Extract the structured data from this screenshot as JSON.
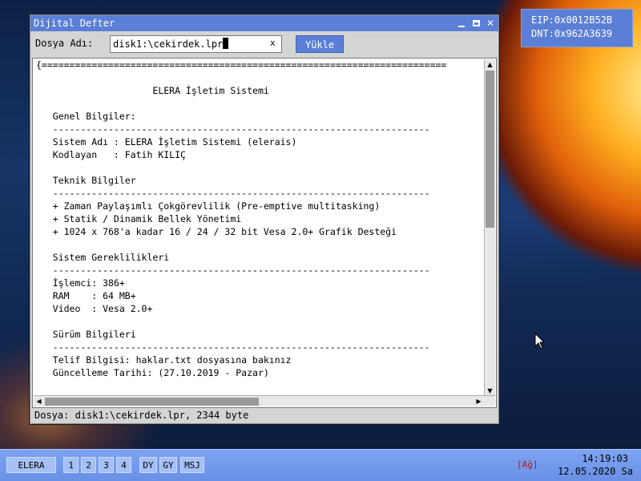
{
  "window": {
    "title": "Dijital Defter",
    "controls": {
      "close": "✕"
    },
    "file_label": "Dosya Adı:",
    "file_input_value": "disk1:\\cekirdek.lpr",
    "clear_label": "x",
    "load_button": "Yükle",
    "text_lines": [
      "{=========================================================================",
      "",
      "                     ELERA İşletim Sistemi",
      "",
      "   Genel Bilgiler:",
      "   --------------------------------------------------------------------",
      "   Sistem Adı : ELERA İşletim Sistemi (elerais)",
      "   Kodlayan   : Fatih KILIÇ",
      "",
      "   Teknik Bilgiler",
      "   --------------------------------------------------------------------",
      "   + Zaman Paylaşımlı Çokgörevlilik (Pre-emptive multitasking)",
      "   + Statik / Dinamik Bellek Yönetimi",
      "   + 1024 x 768'a kadar 16 / 24 / 32 bit Vesa 2.0+ Grafik Desteği",
      "",
      "   Sistem Gereklilikleri",
      "   --------------------------------------------------------------------",
      "   İşlemci: 386+",
      "   RAM    : 64 MB+",
      "   Video  : Vesa 2.0+",
      "",
      "   Sürüm Bilgileri",
      "   --------------------------------------------------------------------",
      "   Telif Bilgisi: haklar.txt dosyasına bakınız",
      "   Güncelleme Tarihi: (27.10.2019 - Pazar)"
    ],
    "scroll": {
      "up": "▲",
      "down": "▼",
      "left": "◀",
      "right": "▶"
    },
    "status": "Dosya: disk1:\\cekirdek.lpr, 2344 byte"
  },
  "registers": {
    "eip": "EIP:0x0012B52B",
    "dnt": "DNT:0x962A3639"
  },
  "taskbar": {
    "start": "ELERA",
    "desktops": [
      "1",
      "2",
      "3",
      "4"
    ],
    "apps": [
      "DY",
      "GY",
      "MSJ"
    ],
    "network": "[Ağ]",
    "time": "14:19:03",
    "date": "12.05.2020 Sa"
  },
  "colors": {
    "accent": "#5b7fd6",
    "taskbar": "#6a90e6",
    "network_alert": "#c21010"
  }
}
